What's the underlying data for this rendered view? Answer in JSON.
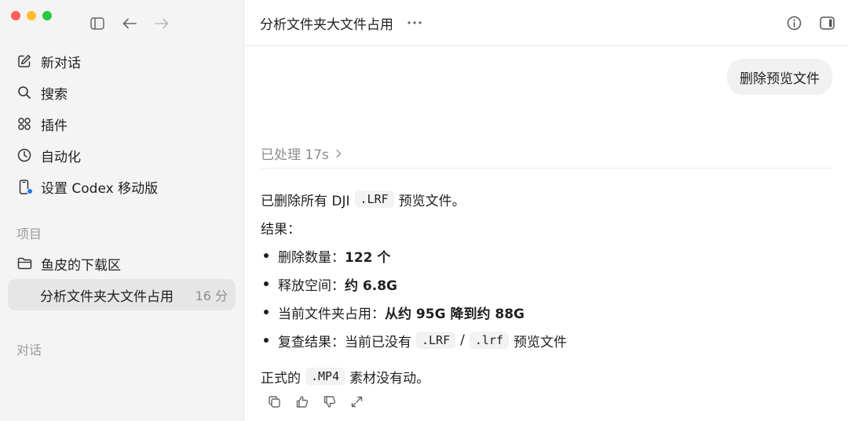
{
  "sidebar": {
    "nav": [
      {
        "label": "新对话",
        "icon": "compose-icon"
      },
      {
        "label": "搜索",
        "icon": "search-icon"
      },
      {
        "label": "插件",
        "icon": "plugins-icon"
      },
      {
        "label": "自动化",
        "icon": "clock-icon"
      },
      {
        "label": "设置 Codex 移动版",
        "icon": "phone-icon"
      }
    ],
    "projects_label": "项目",
    "projects": [
      {
        "label": "鱼皮的下载区",
        "icon": "folder-icon"
      }
    ],
    "active_thread": {
      "label": "分析文件夹大文件占用",
      "time": "16 分"
    },
    "conversations_label": "对话"
  },
  "header": {
    "title": "分析文件夹大文件占用"
  },
  "conversation": {
    "user_message": "删除预览文件",
    "processed": "已处理 17s",
    "answer": {
      "intro_pre": "已删除所有 DJI",
      "intro_code": ".LRF",
      "intro_post": "预览文件。",
      "result_label": "结果：",
      "bullets": [
        {
          "label": "删除数量：",
          "value": "122 个"
        },
        {
          "label": "释放空间：",
          "value": "约 6.8G"
        },
        {
          "label": "当前文件夹占用：",
          "value": "从约 95G 降到约 88G"
        }
      ],
      "recheck_label": "复查结果：",
      "recheck_pre": "当前已没有",
      "recheck_code1": ".LRF",
      "recheck_sep": "/",
      "recheck_code2": ".lrf",
      "recheck_post": "预览文件",
      "footer_pre": "正式的",
      "footer_code": ".MP4",
      "footer_post": "素材没有动。"
    }
  },
  "colors": {
    "sidebar_bg": "#f4f4f4",
    "active_bg": "#e6e6e6",
    "bubble_bg": "#f1f1f1",
    "accent_dot": "#1e7cf2"
  }
}
